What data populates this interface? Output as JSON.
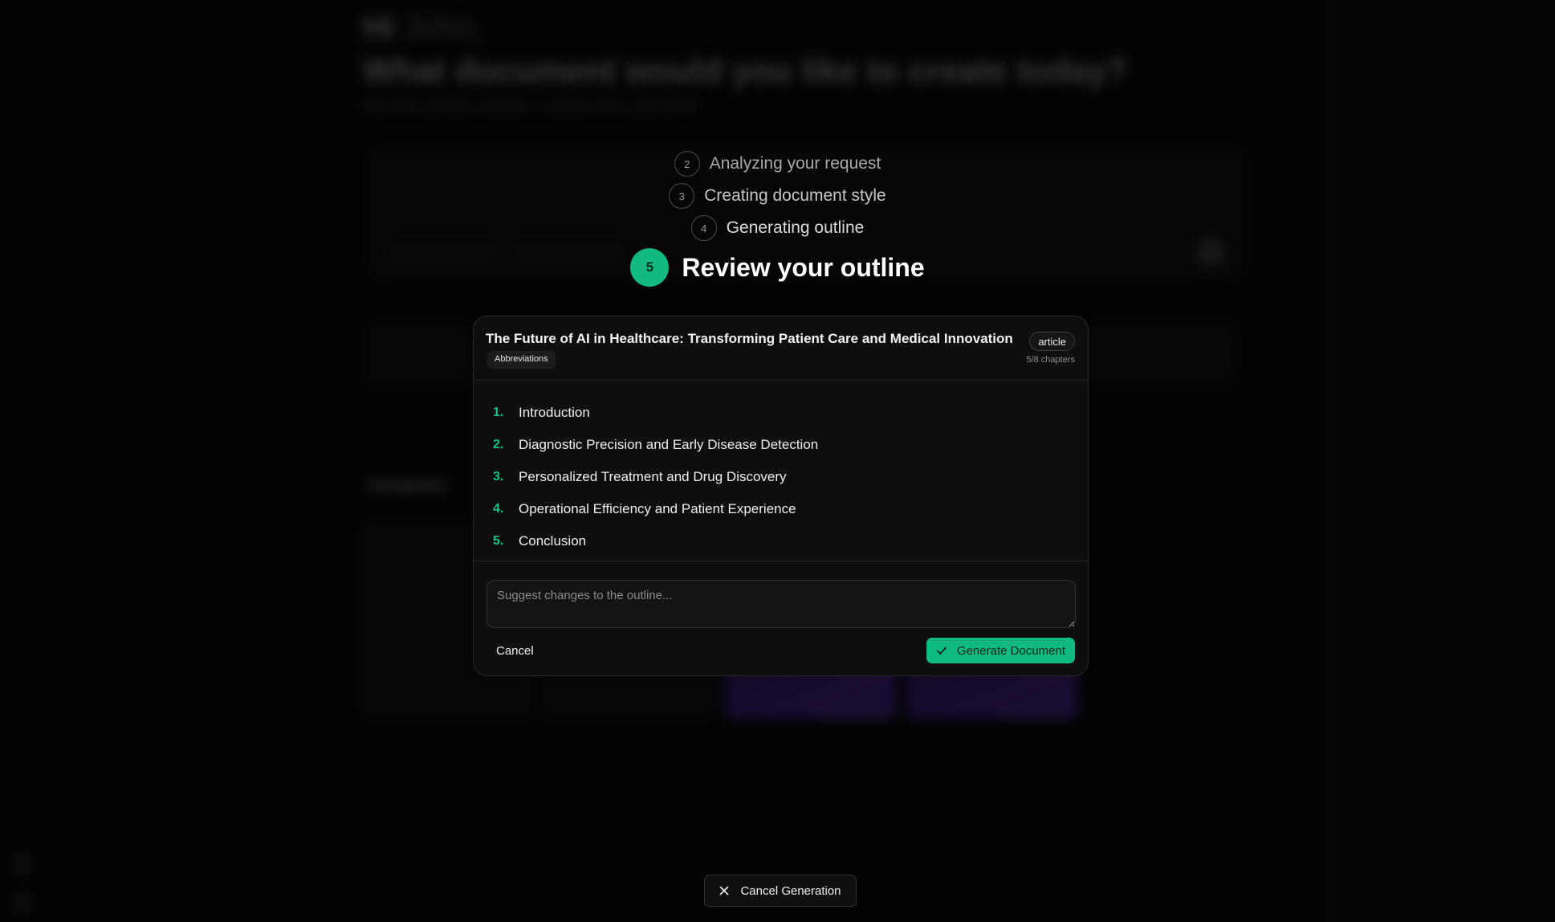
{
  "background": {
    "greeting": "Hi",
    "greeting_name": "John,",
    "question": "What document would you like to create today?",
    "subtitle": "Start with a prompt, template, or upload a file to get started",
    "section_title": "Templates"
  },
  "steps": [
    {
      "number": "2",
      "label": "Analyzing your request"
    },
    {
      "number": "3",
      "label": "Creating document style"
    },
    {
      "number": "4",
      "label": "Generating outline"
    }
  ],
  "active_step": {
    "number": "5",
    "label": "Review your outline"
  },
  "outline_review": {
    "title": "The Future of AI in Healthcare: Transforming Patient Care and Medical Innovation",
    "abbreviations_chip": "Abbreviations",
    "doc_type": "article",
    "chapter_count": "5/8 chapters",
    "chapters": [
      {
        "index": "1.",
        "title": "Introduction"
      },
      {
        "index": "2.",
        "title": "Diagnostic Precision and Early Disease Detection"
      },
      {
        "index": "3.",
        "title": "Personalized Treatment and Drug Discovery"
      },
      {
        "index": "4.",
        "title": "Operational Efficiency and Patient Experience"
      },
      {
        "index": "5.",
        "title": "Conclusion"
      }
    ],
    "suggest_placeholder": "Suggest changes to the outline...",
    "suggest_value": "",
    "cancel_label": "Cancel",
    "generate_label": "Generate Document"
  },
  "cancel_generation_label": "Cancel Generation",
  "colors": {
    "accent": "#10b981",
    "background": "#070707",
    "modal": "#0e0e0e"
  },
  "icons": {
    "generate": "check-icon",
    "cancel_generation": "close-icon"
  }
}
